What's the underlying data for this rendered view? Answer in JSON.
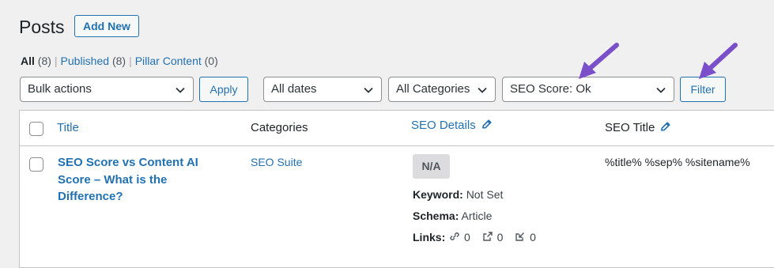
{
  "header": {
    "title": "Posts",
    "add_new_label": "Add New"
  },
  "views": {
    "all_label": "All",
    "all_count": "(8)",
    "published_label": "Published",
    "published_count": "(8)",
    "pillar_label": "Pillar Content",
    "pillar_count": "(0)",
    "separator": "|"
  },
  "filters": {
    "bulk_actions": "Bulk actions",
    "apply_label": "Apply",
    "dates": "All dates",
    "categories": "All Categories",
    "seo_score": "SEO Score: Ok",
    "filter_label": "Filter"
  },
  "table": {
    "columns": {
      "title": "Title",
      "categories": "Categories",
      "seo_details": "SEO Details",
      "seo_title": "SEO Title"
    },
    "rows": [
      {
        "title": "SEO Score vs Content AI Score – What is the Difference?",
        "category": "SEO Suite",
        "score_badge": "N/A",
        "keyword_label": "Keyword:",
        "keyword_value": "Not Set",
        "schema_label": "Schema:",
        "schema_value": "Article",
        "links_label": "Links:",
        "internal_links": "0",
        "external_links": "0",
        "incoming_links": "0",
        "seo_title": "%title% %sep% %sitename%"
      }
    ]
  },
  "colors": {
    "accent": "#2271b1",
    "annotation_arrow": "#7b4fc9"
  }
}
